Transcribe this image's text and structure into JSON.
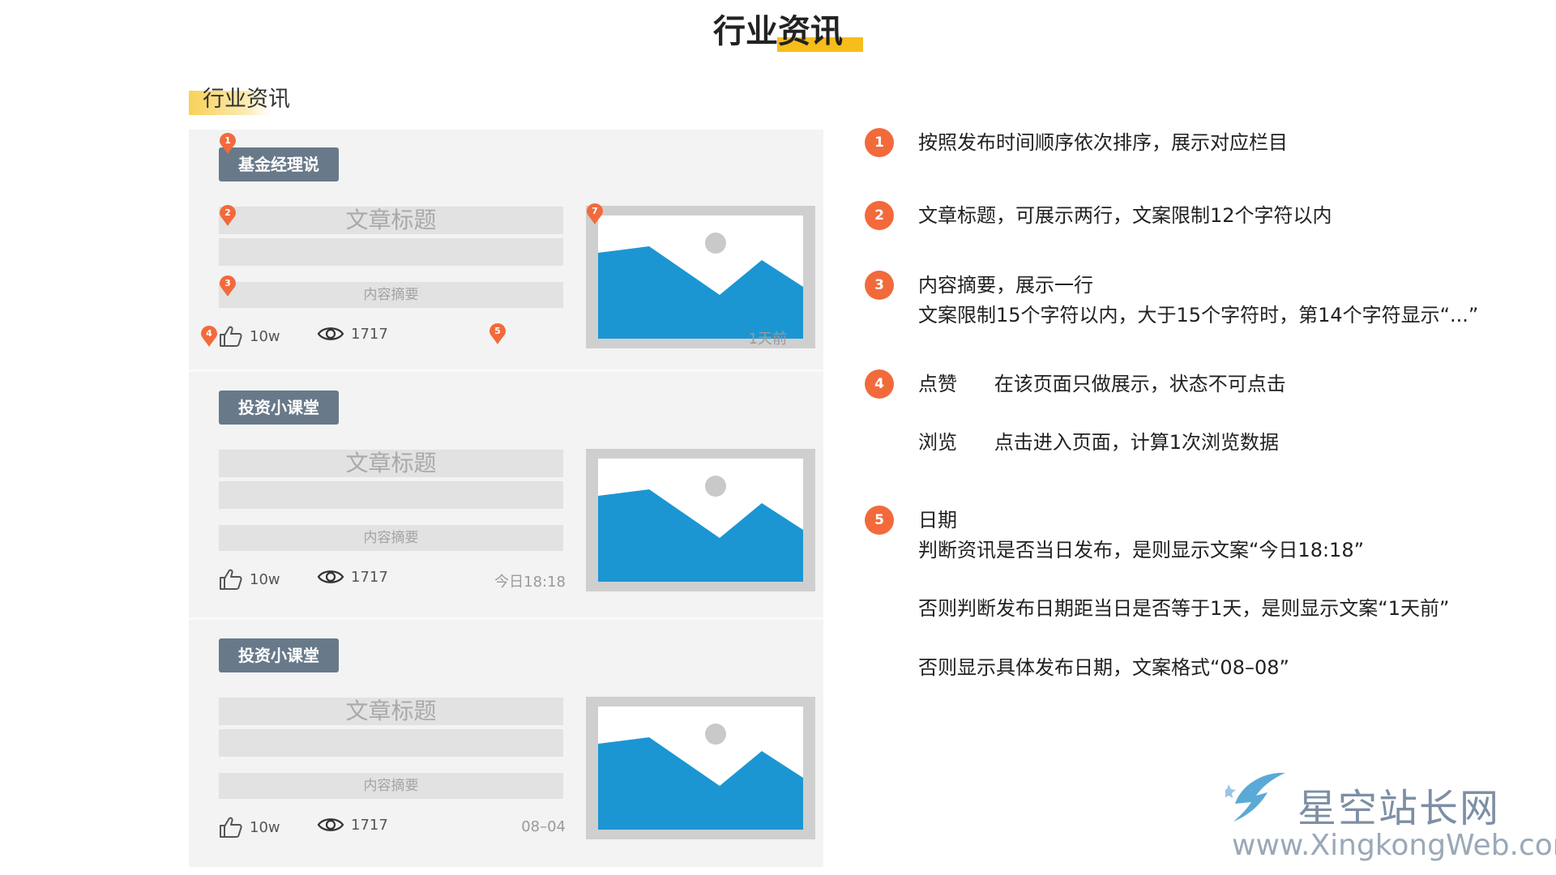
{
  "page_title": "行业资讯",
  "section_title": "行业资讯",
  "cards": [
    {
      "tag": "基金经理说",
      "title": "文章标题",
      "summary": "内容摘要",
      "likes": "10w",
      "views": "1717",
      "date": "1天前"
    },
    {
      "tag": "投资小课堂",
      "title": "文章标题",
      "summary": "内容摘要",
      "likes": "10w",
      "views": "1717",
      "date": "今日18:18"
    },
    {
      "tag": "投资小课堂",
      "title": "文章标题",
      "summary": "内容摘要",
      "likes": "10w",
      "views": "1717",
      "date": "08–04"
    }
  ],
  "markers": [
    "1",
    "2",
    "3",
    "4",
    "5",
    "7"
  ],
  "notes": {
    "n1": {
      "num": "1",
      "text": "按照发布时间顺序依次排序，展示对应栏目"
    },
    "n2": {
      "num": "2",
      "text": "文章标题，可展示两行，文案限制12个字符以内"
    },
    "n3": {
      "num": "3",
      "line1": "内容摘要，展示一行",
      "line2": "文案限制15个字符以内，大于15个字符时，第14个字符显示“...”"
    },
    "n4": {
      "num": "4",
      "line1": "点赞      在该页面只做展示，状态不可点击",
      "line2": "浏览      点击进入页面，计算1次浏览数据"
    },
    "n5": {
      "num": "5",
      "line1": "日期",
      "line2": "判断资讯是否当日发布，是则显示文案“今日18:18”",
      "line3": "否则判断发布日期距当日是否等于1天，是则显示文案“1天前”",
      "line4": "否则显示具体发布日期，文案格式“08–08”"
    }
  },
  "watermark": {
    "brand": "星空站长网",
    "url": "www.XingkongWeb.com"
  },
  "colors": {
    "accent": "#f26a3b",
    "tag_bg": "#687989",
    "highlight": "#f7bd1a",
    "image_blue": "#1b96d3"
  },
  "icons": [
    "thumbs-up-icon",
    "eye-icon",
    "image-placeholder-icon",
    "map-pin-icon"
  ]
}
